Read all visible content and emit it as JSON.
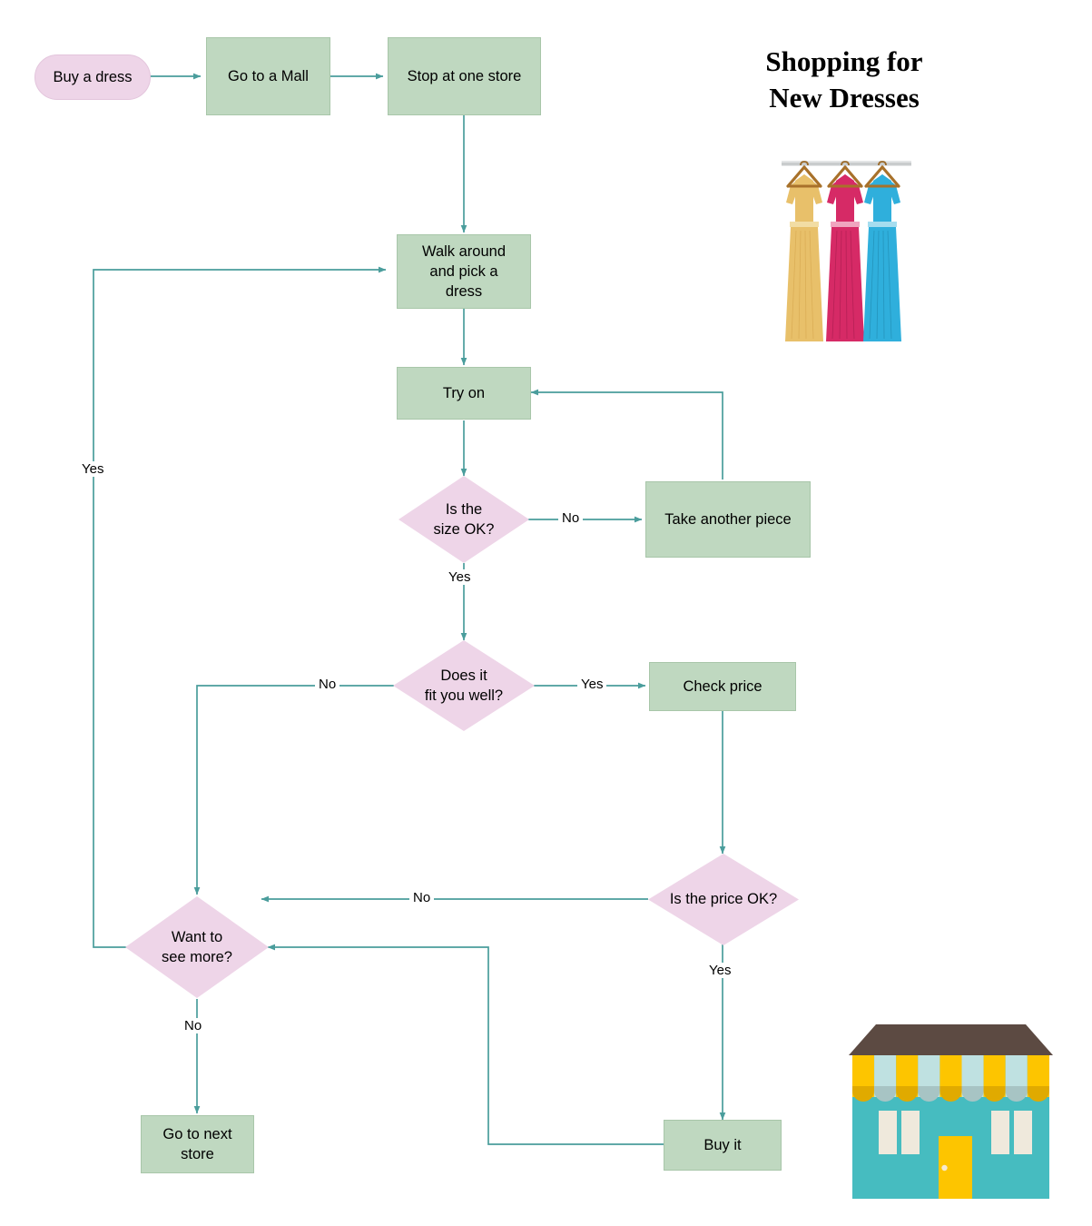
{
  "title": {
    "line1": "Shopping for",
    "line2": "New Dresses"
  },
  "colors": {
    "process_fill": "#bfd8c0",
    "process_border": "#a8c6a9",
    "decision_fill": "#eed5e8",
    "terminator_fill": "#eed5e8",
    "connector": "#4a9d9c",
    "text": "#000000",
    "background": "#ffffff",
    "dress_yellow": "#e8c06a",
    "dress_pink": "#d62a66",
    "dress_blue": "#2fafdc",
    "hanger_brown": "#a8712a",
    "rail_gray": "#b9bcbe",
    "store_roof": "#5c4a42",
    "store_wall": "#46bcc0",
    "store_awning_yellow": "#fdc500",
    "store_awning_blue": "#bfe1e1",
    "store_door": "#fdc500",
    "store_window": "#efe9dc"
  },
  "nodes": [
    {
      "id": "buy-a-dress",
      "label": "Buy a dress",
      "shape": "terminator"
    },
    {
      "id": "go-to-a-mall",
      "label": "Go to a Mall",
      "shape": "process"
    },
    {
      "id": "stop-at-one-store",
      "label": "Stop at one store",
      "shape": "process"
    },
    {
      "id": "walk-around",
      "label": "Walk around\nand pick a\ndress",
      "shape": "process"
    },
    {
      "id": "try-on",
      "label": "Try on",
      "shape": "process"
    },
    {
      "id": "is-the-size-ok",
      "label": "Is the\nsize OK?",
      "shape": "decision"
    },
    {
      "id": "take-another-piece",
      "label": "Take another piece",
      "shape": "process"
    },
    {
      "id": "does-it-fit",
      "label": "Does it\nfit you well?",
      "shape": "decision"
    },
    {
      "id": "check-price",
      "label": "Check price",
      "shape": "process"
    },
    {
      "id": "is-the-price-ok",
      "label": "Is the price OK?",
      "shape": "decision"
    },
    {
      "id": "want-to-see-more",
      "label": "Want to\nsee more?",
      "shape": "decision"
    },
    {
      "id": "go-to-next-store",
      "label": "Go to next\nstore",
      "shape": "process"
    },
    {
      "id": "buy-it",
      "label": "Buy it",
      "shape": "process"
    }
  ],
  "node_labels": {
    "buy_a_dress": "Buy a dress",
    "go_to_a_mall": "Go to a Mall",
    "stop_at_one_store": "Stop at one store",
    "walk_around_l1": "Walk around",
    "walk_around_l2": "and pick a",
    "walk_around_l3": "dress",
    "try_on": "Try on",
    "is_the_size_ok_l1": "Is the",
    "is_the_size_ok_l2": "size OK?",
    "take_another_piece": "Take another piece",
    "does_it_fit_l1": "Does it",
    "does_it_fit_l2": "fit you well?",
    "check_price": "Check price",
    "is_the_price_ok": "Is the price OK?",
    "want_to_see_more_l1": "Want to",
    "want_to_see_more_l2": "see more?",
    "go_to_next_store_l1": "Go to next",
    "go_to_next_store_l2": "store",
    "buy_it": "Buy it"
  },
  "edge_labels": {
    "size_no": "No",
    "size_yes": "Yes",
    "fit_no": "No",
    "fit_yes": "Yes",
    "price_no": "No",
    "price_yes": "Yes",
    "see_more_yes": "Yes",
    "see_more_no": "No"
  },
  "edges": [
    {
      "from": "buy-a-dress",
      "to": "go-to-a-mall",
      "label": ""
    },
    {
      "from": "go-to-a-mall",
      "to": "stop-at-one-store",
      "label": ""
    },
    {
      "from": "stop-at-one-store",
      "to": "walk-around",
      "label": ""
    },
    {
      "from": "walk-around",
      "to": "try-on",
      "label": ""
    },
    {
      "from": "try-on",
      "to": "is-the-size-ok",
      "label": ""
    },
    {
      "from": "is-the-size-ok",
      "to": "take-another-piece",
      "label": "No"
    },
    {
      "from": "take-another-piece",
      "to": "try-on",
      "label": ""
    },
    {
      "from": "is-the-size-ok",
      "to": "does-it-fit",
      "label": "Yes"
    },
    {
      "from": "does-it-fit",
      "to": "want-to-see-more",
      "label": "No"
    },
    {
      "from": "does-it-fit",
      "to": "check-price",
      "label": "Yes"
    },
    {
      "from": "check-price",
      "to": "is-the-price-ok",
      "label": ""
    },
    {
      "from": "is-the-price-ok",
      "to": "want-to-see-more",
      "label": "No"
    },
    {
      "from": "is-the-price-ok",
      "to": "buy-it",
      "label": "Yes"
    },
    {
      "from": "want-to-see-more",
      "to": "walk-around",
      "label": "Yes"
    },
    {
      "from": "want-to-see-more",
      "to": "go-to-next-store",
      "label": "No"
    },
    {
      "from": "buy-it",
      "to": "want-to-see-more",
      "label": ""
    }
  ],
  "illustrations": {
    "dress_rack": "dresses-on-rack-illustration",
    "storefront": "storefront-illustration"
  }
}
